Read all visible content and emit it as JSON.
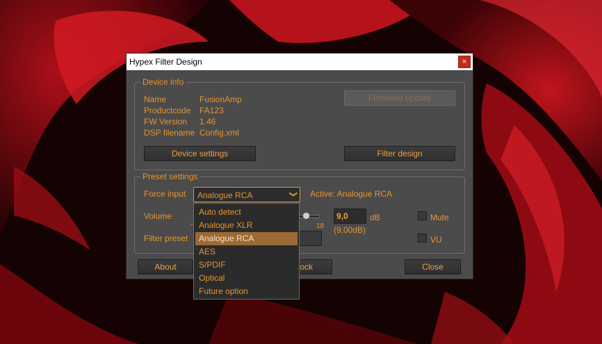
{
  "window": {
    "title": "Hypex Filter Design",
    "close_glyph": "×",
    "close_icon": "close-icon"
  },
  "device_info": {
    "legend": "Device info",
    "rows": [
      {
        "label": "Name",
        "value": "FusionAmp"
      },
      {
        "label": "Productcode",
        "value": "FA123"
      },
      {
        "label": "FW Version",
        "value": "1.46"
      },
      {
        "label": "DSP filename",
        "value": "Config.xml"
      }
    ],
    "firmware_update_label": "Firmware update",
    "device_settings_label": "Device settings",
    "filter_design_label": "Filter design"
  },
  "preset_settings": {
    "legend": "Preset settings",
    "force_input_label": "Force input",
    "force_input_value": "Analogue RCA",
    "active_text": "Active: Analogue RCA",
    "volume_label": "Volume",
    "volume_max_tick": "18",
    "volume_min_tick": "-",
    "volume_value": "9,0",
    "volume_unit": "dB",
    "volume_sub": "(9,00dB)",
    "mute_label": "Mute",
    "vu_label": "VU",
    "filter_preset_label": "Filter preset"
  },
  "dropdown_options": [
    "Auto detect",
    "Analogue XLR",
    "Analogue RCA",
    "AES",
    "S/PDIF",
    "Optical",
    "Future option"
  ],
  "selected_option": "Analogue RCA",
  "bottom": {
    "about_label": "About",
    "lock_label": "ock",
    "close_label": "Close"
  },
  "colors": {
    "accent": "#e8932e",
    "window_bg": "#4b4b4b",
    "selected_bg": "#9c6a35"
  }
}
